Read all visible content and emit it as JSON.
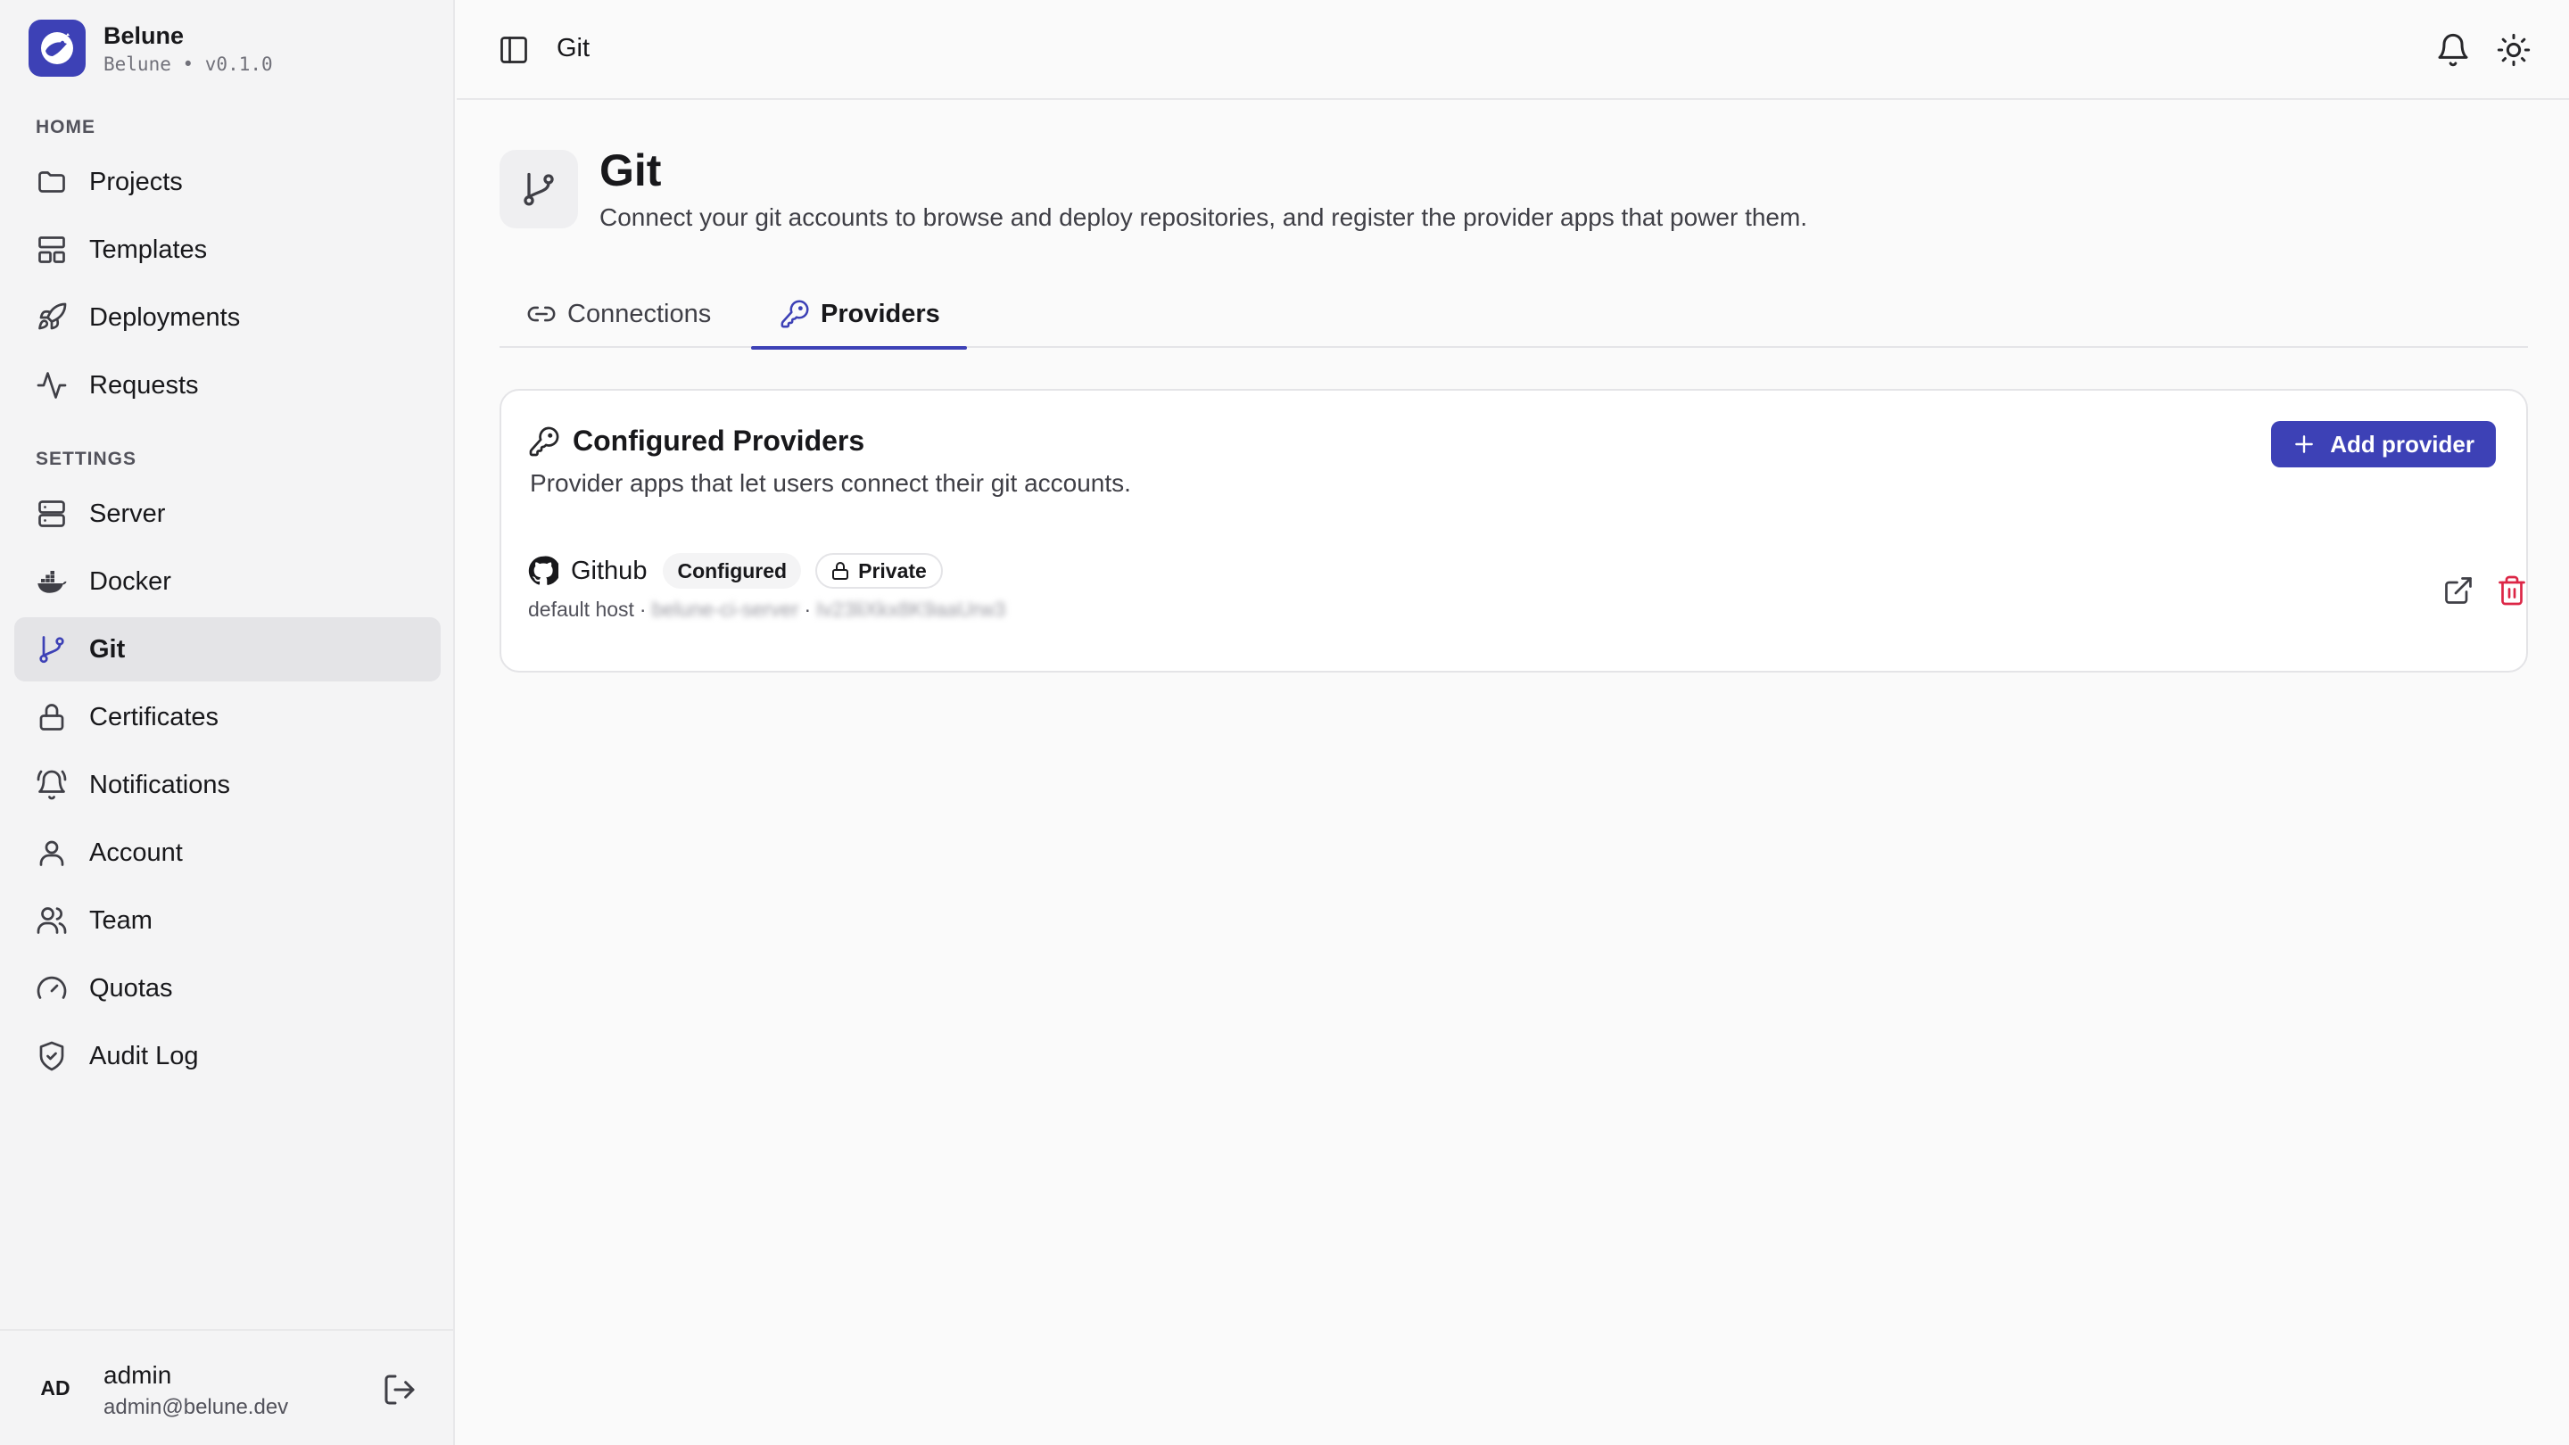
{
  "app": {
    "name": "Belune",
    "subtitle": "Belune • v0.1.0"
  },
  "sidebar": {
    "sections": [
      {
        "label": "HOME"
      },
      {
        "label": "SETTINGS"
      }
    ],
    "items": [
      {
        "label": "Projects",
        "icon": "folder-icon"
      },
      {
        "label": "Templates",
        "icon": "layout-template-icon"
      },
      {
        "label": "Deployments",
        "icon": "rocket-icon"
      },
      {
        "label": "Requests",
        "icon": "activity-icon"
      },
      {
        "label": "Server",
        "icon": "server-icon"
      },
      {
        "label": "Docker",
        "icon": "docker-icon"
      },
      {
        "label": "Git",
        "icon": "git-branch-icon",
        "active": true
      },
      {
        "label": "Certificates",
        "icon": "lock-icon"
      },
      {
        "label": "Notifications",
        "icon": "bell-ring-icon"
      },
      {
        "label": "Account",
        "icon": "user-icon"
      },
      {
        "label": "Team",
        "icon": "users-icon"
      },
      {
        "label": "Quotas",
        "icon": "gauge-icon"
      },
      {
        "label": "Audit Log",
        "icon": "shield-check-icon"
      }
    ]
  },
  "user": {
    "initials": "AD",
    "name": "admin",
    "email": "admin@belune.dev"
  },
  "topbar": {
    "title": "Git"
  },
  "page": {
    "title": "Git",
    "description": "Connect your git accounts to browse and deploy repositories, and register the provider apps that power them."
  },
  "tabs": [
    {
      "label": "Connections",
      "icon": "link-icon"
    },
    {
      "label": "Providers",
      "icon": "key-icon",
      "active": true
    }
  ],
  "card": {
    "title": "Configured Providers",
    "description": "Provider apps that let users connect their git accounts.",
    "add_button": "Add provider"
  },
  "providers": [
    {
      "name": "Github",
      "status_badge": "Configured",
      "visibility_badge": "Private",
      "host_label": "default host",
      "separator": "·",
      "redacted_1": "belune-ci-server",
      "redacted_2": "Iv23liXkx8K9aaUrw3"
    }
  ],
  "colors": {
    "accent": "#3d41b6",
    "danger": "#dc2646",
    "sidebar_bg": "#f4f4f5",
    "page_bg": "#fafafa"
  }
}
